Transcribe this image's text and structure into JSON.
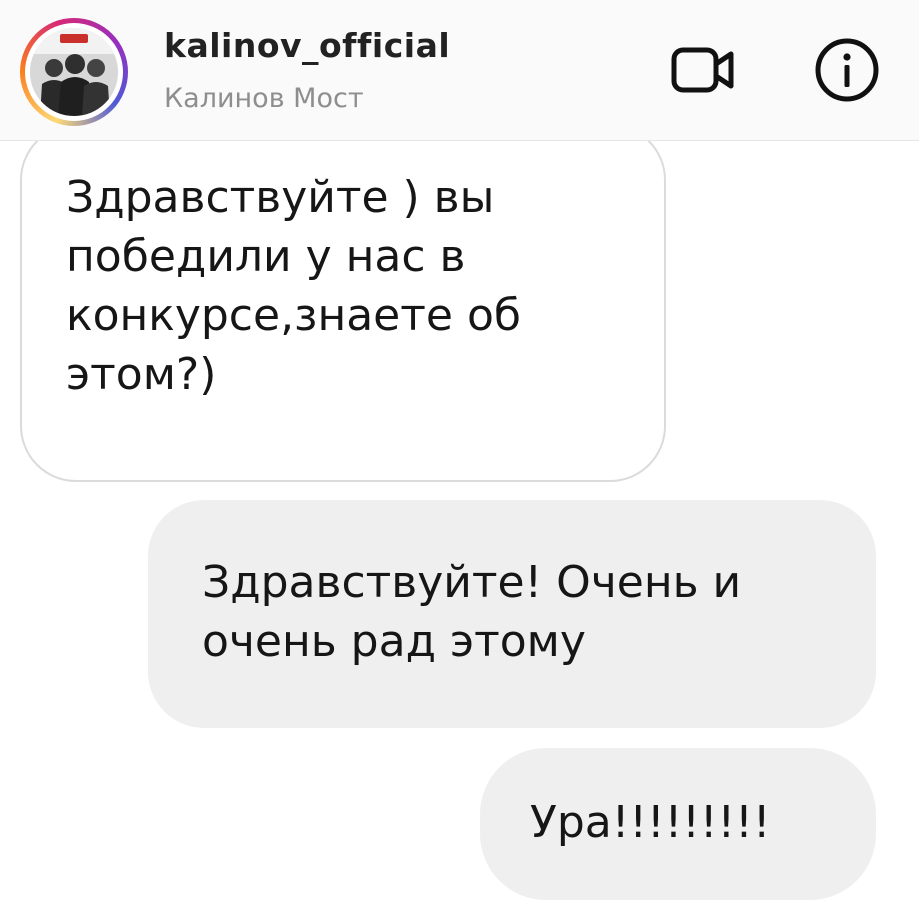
{
  "header": {
    "username": "kalinov_official",
    "display_name": "Калинов Мост",
    "avatar_icon": "band-photo-avatar",
    "video_icon": "video-camera-icon",
    "info_icon": "info-icon"
  },
  "messages": [
    {
      "direction": "incoming",
      "text": "Здравствуйте ) вы победили у нас в конкурсе,знаете об этом?)"
    },
    {
      "direction": "outgoing",
      "text": "Здравствуйте! Очень и очень рад этому"
    },
    {
      "direction": "outgoing",
      "text": "Ура!!!!!!!!!"
    }
  ],
  "colors": {
    "header_bg": "#fafafa",
    "outgoing_bubble": "#efefef",
    "incoming_border": "#dbdbdb",
    "secondary_text": "#8e8e8e"
  }
}
